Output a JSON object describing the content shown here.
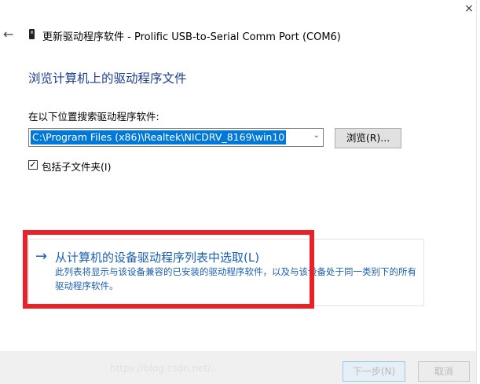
{
  "window": {
    "title": "更新驱动程序软件 - Prolific USB-to-Serial Comm Port (COM6)",
    "close_glyph": "×",
    "back_glyph": "←"
  },
  "main": {
    "heading": "浏览计算机上的驱动程序文件",
    "search_label": "在以下位置搜索驱动程序软件:",
    "path_value": "C:\\Program Files (x86)\\Realtek\\NICDRV_8169\\win10",
    "combo_arrow_glyph": "⌄",
    "browse_label": "浏览(R)...",
    "include_subfolders": {
      "checked": true,
      "check_glyph": "✓",
      "label": "包括子文件夹(I)"
    }
  },
  "pick_option": {
    "arrow_glyph": "→",
    "title": "从计算机的设备驱动程序列表中选取(L)",
    "description": "此列表将显示与该设备兼容的已安装的驱动程序软件，以及与该设备处于同一类别下的所有驱动程序软件。"
  },
  "footer": {
    "watermark": "https://blog.csdn.net/...",
    "next_label": "下一步(N)",
    "cancel_label": "取消"
  },
  "colors": {
    "accent_blue": "#1a5fb4",
    "heading_blue": "#1a3d8f",
    "selection": "#0078d7",
    "annotation_red": "#ea2127"
  }
}
